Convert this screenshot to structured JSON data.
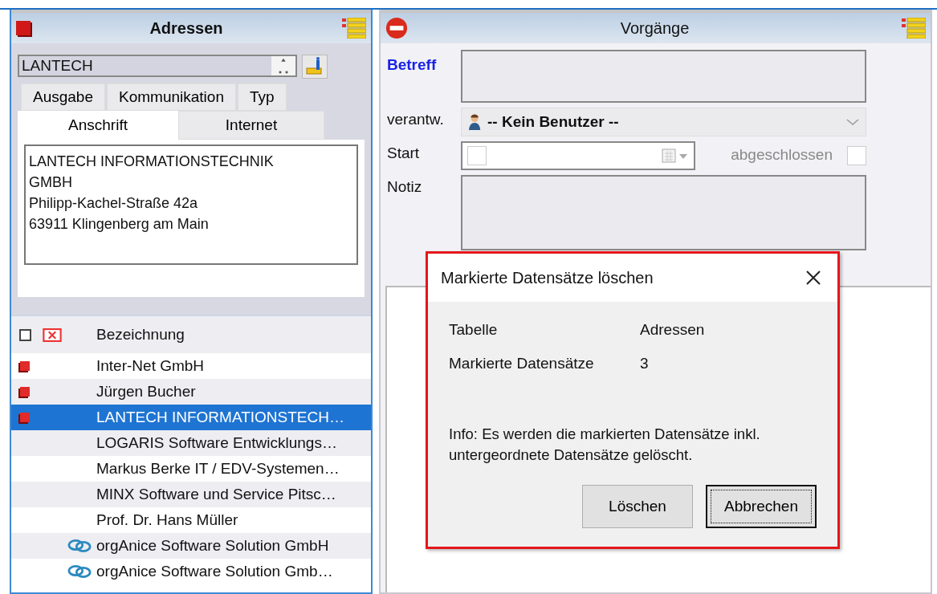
{
  "addresses": {
    "title": "Adressen",
    "search": {
      "value": "LANTECH"
    },
    "tab_rows": [
      {
        "tabs": [
          {
            "label": "Ausgabe",
            "selected": false
          },
          {
            "label": "Kommunikation",
            "selected": false
          },
          {
            "label": "Typ",
            "selected": false
          }
        ]
      },
      {
        "tabs": [
          {
            "label": "Anschrift",
            "selected": true
          },
          {
            "label": "Internet",
            "selected": false
          }
        ]
      }
    ],
    "address_lines": [
      "LANTECH INFORMATIONSTECHNIK",
      "GMBH",
      "Philipp-Kachel-Straße 42a",
      "63911 Klingenberg am Main"
    ],
    "table": {
      "columns": [
        "Bezeichnung"
      ],
      "rows": [
        {
          "label": "Inter-Net GmbH",
          "marked": true,
          "linked": false,
          "selected": false
        },
        {
          "label": "Jürgen Bucher",
          "marked": true,
          "linked": false,
          "selected": false
        },
        {
          "label": "LANTECH INFORMATIONSTECH…",
          "marked": true,
          "linked": false,
          "selected": true
        },
        {
          "label": "LOGARIS Software Entwicklungs…",
          "marked": false,
          "linked": false,
          "selected": false
        },
        {
          "label": "Markus Berke IT / EDV-Systemen…",
          "marked": false,
          "linked": false,
          "selected": false
        },
        {
          "label": "MINX Software und Service Pitsc…",
          "marked": false,
          "linked": false,
          "selected": false
        },
        {
          "label": "Prof. Dr. Hans Müller",
          "marked": false,
          "linked": false,
          "selected": false
        },
        {
          "label": "orgAnice Software Solution GmbH",
          "marked": false,
          "linked": true,
          "selected": false
        },
        {
          "label": "orgAnice Software Solution Gmb…",
          "marked": false,
          "linked": true,
          "selected": false
        }
      ]
    }
  },
  "tasks": {
    "title": "Vorgänge",
    "subject_label": "Betreff",
    "owner_label": "verantw.",
    "owner_value": "-- Kein Benutzer --",
    "start_label": "Start",
    "start_checked": false,
    "closed_label": "abgeschlossen",
    "closed_checked": false,
    "closed_disabled": true,
    "note_label": "Notiz"
  },
  "dialog": {
    "title": "Markierte Datensätze löschen",
    "fields": [
      {
        "label": "Tabelle",
        "value": "Adressen"
      },
      {
        "label": "Markierte Datensätze",
        "value": "3"
      }
    ],
    "info": "Info: Es werden die markierten Datensätze inkl. untergeordnete Datensätze gelöscht.",
    "buttons": [
      {
        "label": "Löschen",
        "default": false
      },
      {
        "label": "Abbrechen",
        "default": true
      }
    ]
  }
}
